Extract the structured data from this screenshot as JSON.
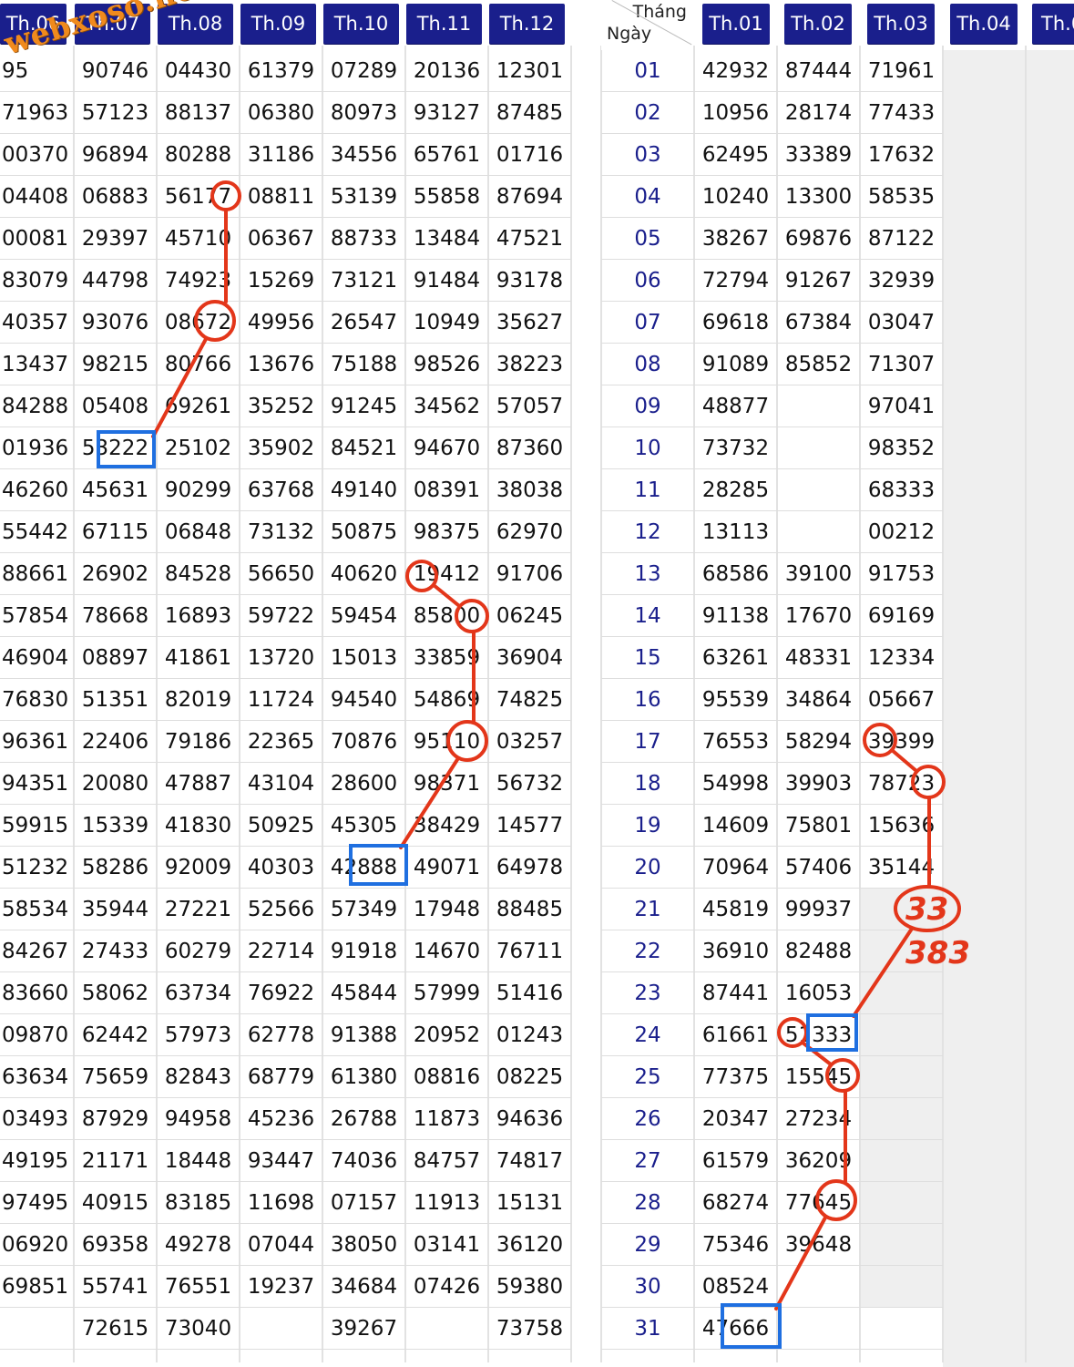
{
  "watermark": "webxoso.net",
  "left_headers": [
    "Th.06",
    "Th.07",
    "Th.08",
    "Th.09",
    "Th.10",
    "Th.11",
    "Th.12"
  ],
  "right_corner": {
    "top": "Tháng",
    "bottom": "Ngày"
  },
  "right_headers": [
    "Th.01",
    "Th.02",
    "Th.03",
    "Th.04",
    "Th.0"
  ],
  "left_rows": [
    [
      "95",
      "90746",
      "04430",
      "61379",
      "07289",
      "20136",
      "12301"
    ],
    [
      "71963",
      "57123",
      "88137",
      "06380",
      "80973",
      "93127",
      "87485"
    ],
    [
      "00370",
      "96894",
      "80288",
      "31186",
      "34556",
      "65761",
      "01716"
    ],
    [
      "04408",
      "06883",
      "56177",
      "08811",
      "53139",
      "55858",
      "87694"
    ],
    [
      "00081",
      "29397",
      "45710",
      "06367",
      "88733",
      "13484",
      "47521"
    ],
    [
      "83079",
      "44798",
      "74923",
      "15269",
      "73121",
      "91484",
      "93178"
    ],
    [
      "40357",
      "93076",
      "08672",
      "49956",
      "26547",
      "10949",
      "35627"
    ],
    [
      "13437",
      "98215",
      "80766",
      "13676",
      "75188",
      "98526",
      "38223"
    ],
    [
      "84288",
      "05408",
      "69261",
      "35252",
      "91245",
      "34562",
      "57057"
    ],
    [
      "01936",
      "53222",
      "25102",
      "35902",
      "84521",
      "94670",
      "87360"
    ],
    [
      "46260",
      "45631",
      "90299",
      "63768",
      "49140",
      "08391",
      "38038"
    ],
    [
      "55442",
      "67115",
      "06848",
      "73132",
      "50875",
      "98375",
      "62970"
    ],
    [
      "88661",
      "26902",
      "84528",
      "56650",
      "40620",
      "19412",
      "91706"
    ],
    [
      "57854",
      "78668",
      "16893",
      "59722",
      "59454",
      "85800",
      "06245"
    ],
    [
      "46904",
      "08897",
      "41861",
      "13720",
      "15013",
      "33859",
      "36904"
    ],
    [
      "76830",
      "51351",
      "82019",
      "11724",
      "94540",
      "54869",
      "74825"
    ],
    [
      "96361",
      "22406",
      "79186",
      "22365",
      "70876",
      "95110",
      "03257"
    ],
    [
      "94351",
      "20080",
      "47887",
      "43104",
      "28600",
      "98371",
      "56732"
    ],
    [
      "59915",
      "15339",
      "41830",
      "50925",
      "45305",
      "38429",
      "14577"
    ],
    [
      "51232",
      "58286",
      "92009",
      "40303",
      "42888",
      "49071",
      "64978"
    ],
    [
      "58534",
      "35944",
      "27221",
      "52566",
      "57349",
      "17948",
      "88485"
    ],
    [
      "84267",
      "27433",
      "60279",
      "22714",
      "91918",
      "14670",
      "76711"
    ],
    [
      "83660",
      "58062",
      "63734",
      "76922",
      "45844",
      "57999",
      "51416"
    ],
    [
      "09870",
      "62442",
      "57973",
      "62778",
      "91388",
      "20952",
      "01243"
    ],
    [
      "63634",
      "75659",
      "82843",
      "68779",
      "61380",
      "08816",
      "08225"
    ],
    [
      "03493",
      "87929",
      "94958",
      "45236",
      "26788",
      "11873",
      "94636"
    ],
    [
      "49195",
      "21171",
      "18448",
      "93447",
      "74036",
      "84757",
      "74817"
    ],
    [
      "97495",
      "40915",
      "83185",
      "11698",
      "07157",
      "11913",
      "15131"
    ],
    [
      "06920",
      "69358",
      "49278",
      "07044",
      "38050",
      "03141",
      "36120"
    ],
    [
      "69851",
      "55741",
      "76551",
      "19237",
      "34684",
      "07426",
      "59380"
    ],
    [
      "",
      "72615",
      "73040",
      "",
      "39267",
      "",
      "73758"
    ]
  ],
  "right_rows": [
    [
      "01",
      "42932",
      "87444",
      "71961"
    ],
    [
      "02",
      "10956",
      "28174",
      "77433"
    ],
    [
      "03",
      "62495",
      "33389",
      "17632"
    ],
    [
      "04",
      "10240",
      "13300",
      "58535"
    ],
    [
      "05",
      "38267",
      "69876",
      "87122"
    ],
    [
      "06",
      "72794",
      "91267",
      "32939"
    ],
    [
      "07",
      "69618",
      "67384",
      "03047"
    ],
    [
      "08",
      "91089",
      "85852",
      "71307"
    ],
    [
      "09",
      "48877",
      "",
      "97041"
    ],
    [
      "10",
      "73732",
      "",
      "98352"
    ],
    [
      "11",
      "28285",
      "",
      "68333"
    ],
    [
      "12",
      "13113",
      "",
      "00212"
    ],
    [
      "13",
      "68586",
      "39100",
      "91753"
    ],
    [
      "14",
      "91138",
      "17670",
      "69169"
    ],
    [
      "15",
      "63261",
      "48331",
      "12334"
    ],
    [
      "16",
      "95539",
      "34864",
      "05667"
    ],
    [
      "17",
      "76553",
      "58294",
      "39399"
    ],
    [
      "18",
      "54998",
      "39903",
      "78723"
    ],
    [
      "19",
      "14609",
      "75801",
      "15636"
    ],
    [
      "20",
      "70964",
      "57406",
      "35144"
    ],
    [
      "21",
      "45819",
      "99937",
      ""
    ],
    [
      "22",
      "36910",
      "82488",
      ""
    ],
    [
      "23",
      "87441",
      "16053",
      ""
    ],
    [
      "24",
      "61661",
      "51333",
      ""
    ],
    [
      "25",
      "77375",
      "15545",
      ""
    ],
    [
      "26",
      "20347",
      "27234",
      ""
    ],
    [
      "27",
      "61579",
      "36209",
      ""
    ],
    [
      "28",
      "68274",
      "77645",
      ""
    ],
    [
      "29",
      "75346",
      "39648",
      ""
    ],
    [
      "30",
      "08524",
      "",
      ""
    ],
    [
      "31",
      "47666",
      "",
      ""
    ]
  ],
  "annotations": {
    "handwritten_1": "33",
    "handwritten_2": "383"
  },
  "colors": {
    "header_bg": "#1a1f8c",
    "day_text": "#1a1f8c",
    "marker_red": "#e3361a",
    "highlight_blue": "#1f6fe0",
    "watermark": "#f08a1d"
  }
}
